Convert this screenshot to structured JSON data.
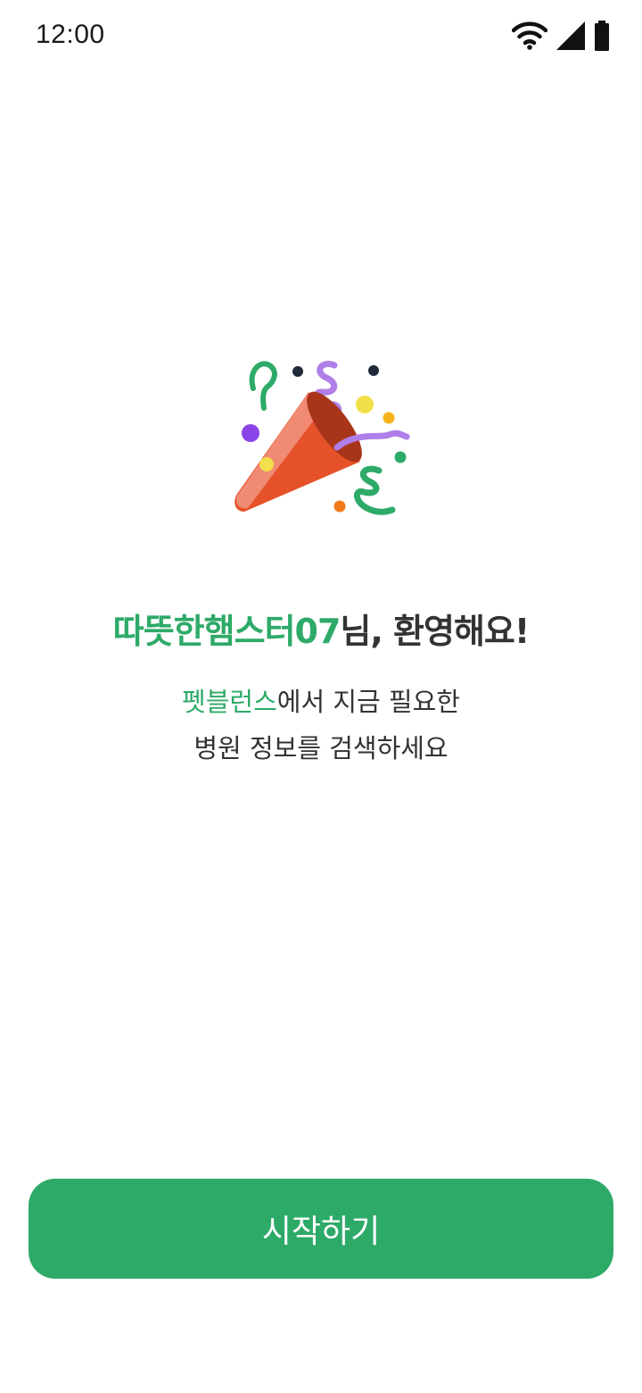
{
  "status_bar": {
    "time": "12:00",
    "icons": [
      "wifi-icon",
      "signal-icon",
      "battery-icon"
    ]
  },
  "illustration": {
    "icon": "party-popper-icon"
  },
  "welcome": {
    "nickname": "따뜻한햄스터07",
    "greeting_suffix": "님, 환영해요!"
  },
  "subtitle": {
    "brand": "펫블런스",
    "line1_suffix": "에서 지금 필요한",
    "line2": "병원 정보를 검색하세요"
  },
  "actions": {
    "start_label": "시작하기"
  },
  "colors": {
    "accent": "#2eaa68",
    "text": "#333333",
    "background": "#ffffff"
  }
}
